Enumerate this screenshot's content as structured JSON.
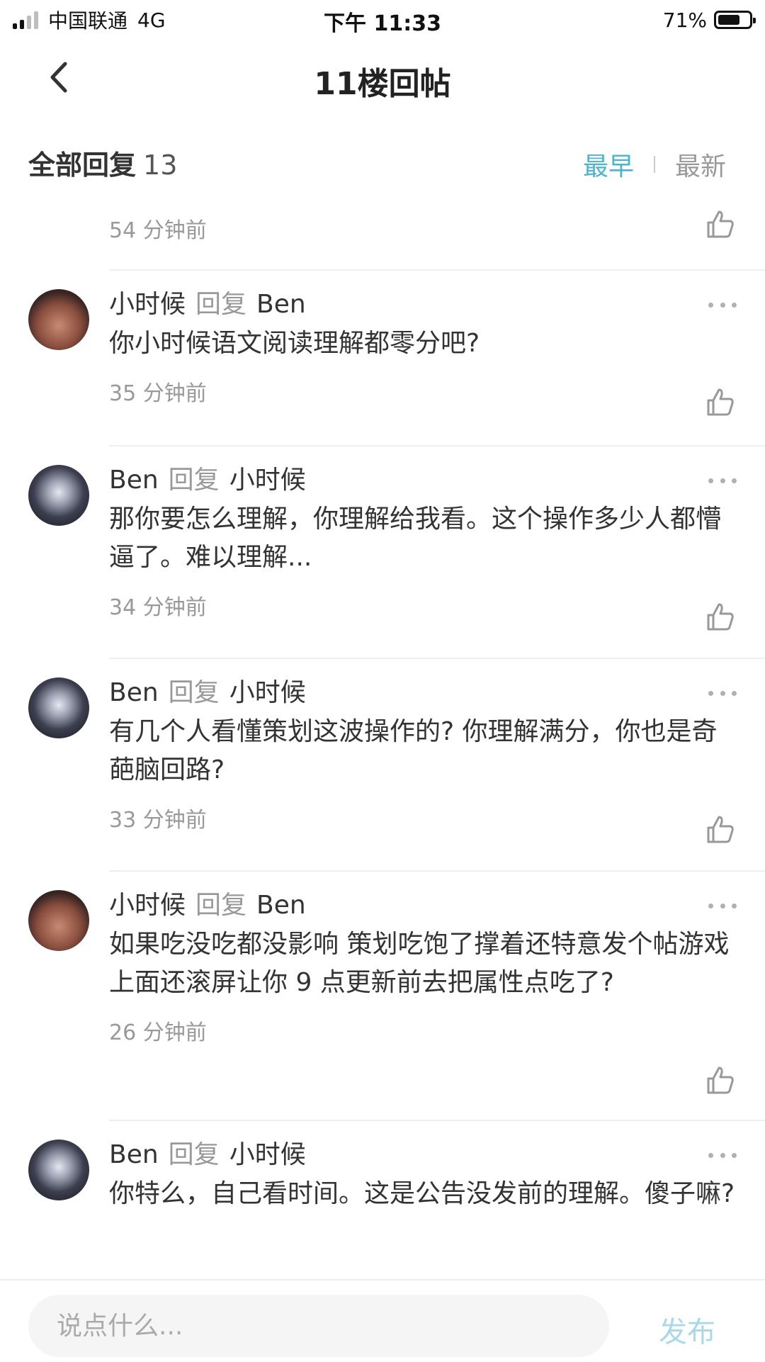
{
  "status_bar": {
    "carrier": "中国联通",
    "network": "4G",
    "time": "下午 11:33",
    "battery": "71%",
    "battery_level": 0.71
  },
  "header": {
    "title": "11楼回帖",
    "back_icon": "chevron-left-icon"
  },
  "replies": {
    "label": "全部回复",
    "count": "13",
    "sort_earliest": "最早",
    "sort_latest": "最新",
    "accent_color": "#4cb4cf"
  },
  "top_item": {
    "time": "54 分钟前"
  },
  "comments": [
    {
      "user": "小时候",
      "reply_word": "回复",
      "target": "Ben",
      "text": "你小时候语文阅读理解都零分吧?",
      "time": "35 分钟前"
    },
    {
      "user": "Ben",
      "reply_word": "回复",
      "target": "小时候",
      "text": "那你要怎么理解，你理解给我看。这个操作多少人都懵逼了。难以理解...",
      "time": "34 分钟前"
    },
    {
      "user": "Ben",
      "reply_word": "回复",
      "target": "小时候",
      "text": "有几个人看懂策划这波操作的? 你理解满分，你也是奇葩脑回路?",
      "time": "33 分钟前"
    },
    {
      "user": "小时候",
      "reply_word": "回复",
      "target": "Ben",
      "text": "如果吃没吃都没影响 策划吃饱了撑着还特意发个帖游戏上面还滚屏让你 9 点更新前去把属性点吃了?",
      "time": "26 分钟前"
    },
    {
      "user": "Ben",
      "reply_word": "回复",
      "target": "小时候",
      "text": "你特么，自己看时间。这是公告没发前的理解。傻子嘛?",
      "time": ""
    }
  ],
  "bottom": {
    "placeholder": "说点什么...",
    "publish": "发布"
  }
}
